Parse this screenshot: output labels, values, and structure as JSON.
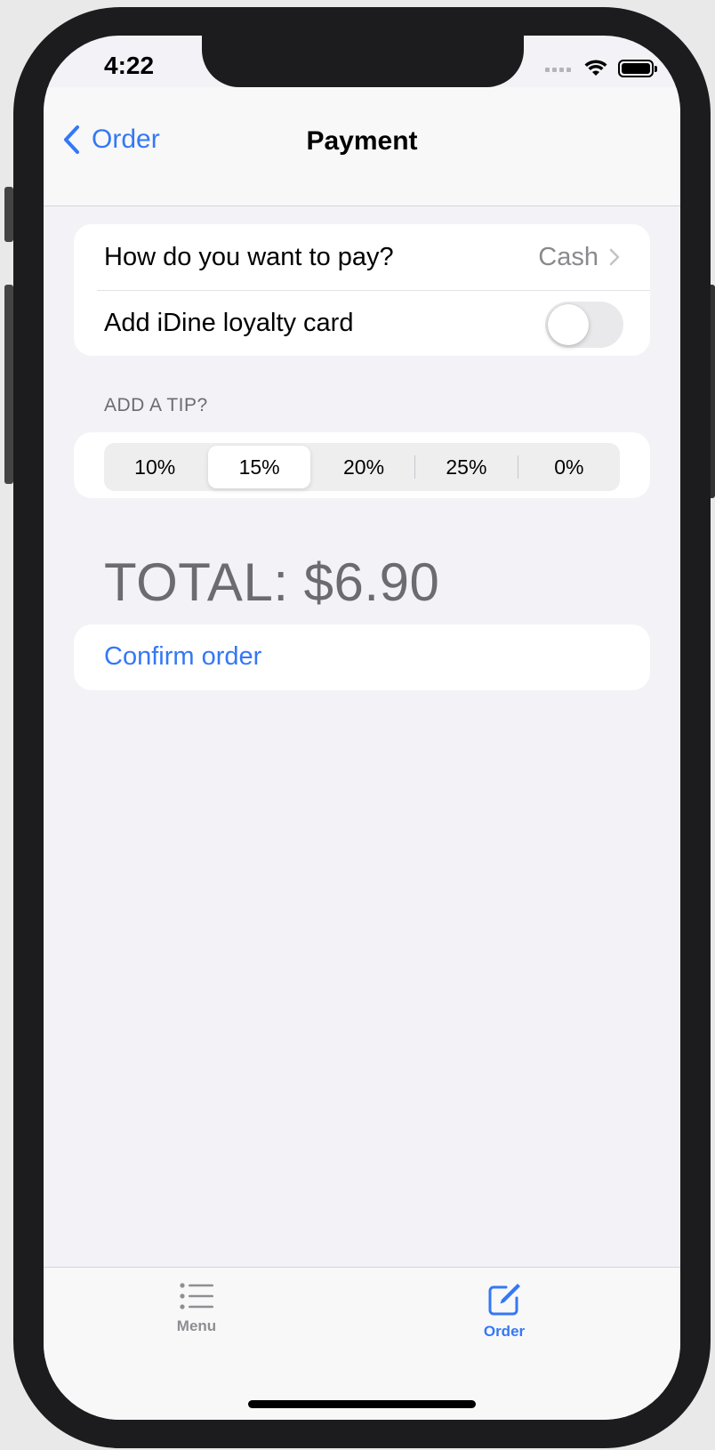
{
  "status_bar": {
    "time": "4:22"
  },
  "nav": {
    "back_label": "Order",
    "title": "Payment"
  },
  "payment": {
    "question": "How do you want to pay?",
    "method": "Cash",
    "loyalty_label": "Add iDine loyalty card",
    "loyalty_enabled": false
  },
  "tip": {
    "header": "ADD A TIP?",
    "options": [
      "10%",
      "15%",
      "20%",
      "25%",
      "0%"
    ],
    "selected": "15%"
  },
  "total": "TOTAL: $6.90",
  "confirm_label": "Confirm order",
  "tabs": [
    {
      "label": "Menu",
      "icon": "list-icon",
      "selected": false
    },
    {
      "label": "Order",
      "icon": "square-and-pencil-icon",
      "selected": true
    }
  ],
  "colors": {
    "accent": "#3478f6",
    "grouped_bg": "#f2f2f7",
    "secondary_text": "#6c6c70"
  }
}
